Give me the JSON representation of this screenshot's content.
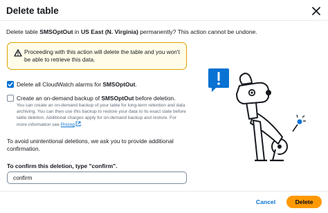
{
  "dialog": {
    "title": "Delete table",
    "close_icon": "close-icon"
  },
  "description": {
    "prefix": "Delete table ",
    "table_name": "SMSOptOut",
    "middle": " in ",
    "region": "US East (N. Virginia)",
    "suffix": " permanently? This action cannot be undone."
  },
  "warning": {
    "icon": "warning-icon",
    "text": "Proceeding with this action will delete the table and you won't be able to retrieve this data."
  },
  "options": {
    "delete_alarms": {
      "checked": true,
      "prefix": "Delete all CloudWatch alarms for ",
      "table_name": "SMSOptOut",
      "suffix": "."
    },
    "create_backup": {
      "checked": false,
      "prefix": "Create an on-demand backup of ",
      "table_name": "SMSOptOut",
      "suffix": " before deletion.",
      "description": "You can create an on-demand backup of your table for long-term retention and data archiving. You can then use this backup to restore your data to its exact state before table deletion. Additional charges apply for on-demand backup and restore. For more information see ",
      "link_text": "Pricing",
      "link_icon": "external-link-icon",
      "description_end": "."
    }
  },
  "confirmation": {
    "info": "To avoid unintentional deletions, we ask you to provide additional confirmation.",
    "label": "To confirm this deletion, type \"confirm\".",
    "value": "confirm"
  },
  "footer": {
    "cancel_label": "Cancel",
    "delete_label": "Delete"
  },
  "colors": {
    "accent": "#0972d3",
    "delete_button": "#ff9900",
    "warning_border": "#dba200",
    "warning_bg": "#fffce9"
  }
}
